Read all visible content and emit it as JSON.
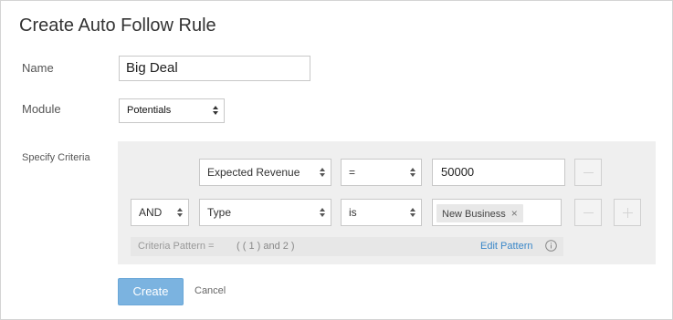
{
  "dialog": {
    "title": "Create Auto Follow Rule"
  },
  "form": {
    "name_label": "Name",
    "name_value": "Big Deal",
    "module_label": "Module",
    "module_value": "Potentials",
    "criteria_label": "Specify Criteria"
  },
  "criteria": {
    "rows": [
      {
        "field": "Expected Revenue",
        "operator": "=",
        "value": "50000"
      },
      {
        "connector": "AND",
        "field": "Type",
        "operator": "is",
        "value_tag": "New Business",
        "tag_remove": "×"
      }
    ],
    "pattern_label": "Criteria Pattern =",
    "pattern_value": "( ( 1 ) and 2 )",
    "edit_pattern": "Edit Pattern"
  },
  "actions": {
    "create": "Create",
    "cancel": "Cancel"
  },
  "colors": {
    "primary_button": "#7bb3e0",
    "link": "#3a87c8",
    "panel_bg": "#efefef"
  },
  "icons": {
    "remove_row": "minus-icon",
    "add_row": "plus-icon",
    "info": "info-icon",
    "select_arrows": "updown-arrows-icon"
  }
}
